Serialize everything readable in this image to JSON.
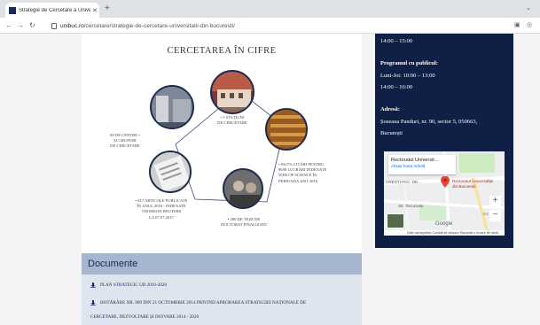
{
  "browser": {
    "tab_title": "Strategie de Cercetare a Universit",
    "new_tab": "+",
    "url_host": "unibuc.ro",
    "url_path": "/cercetare/strategie-de-cercetare-universitatii-din-bucuresti/"
  },
  "research": {
    "title": "CERCETAREA ÎN CIFRE",
    "captions": [
      "• 5 STAȚIUNI\nDE CERCETARE",
      "• 9327% CITĂRI PENTRU\n9698 LUCRĂRI INDEXATE\nWEB OF SCIENCE ÎN\nPERIOADA 2001-2016",
      "• 280 DE TEZE DE\nDOCTORAT FINALIZATE",
      "• 817 ARTICOLE PUBLICATE\nÎN ANUL 2016 - INDEXATE\nTHOMSON-REUTERS\nLA 07.07.2017",
      "80 DE CENTRE •\nȘI GRUPURI\nDE CERCETARE"
    ]
  },
  "documents": {
    "heading": "Documente",
    "items": [
      "PLAN STRATEGIC UB 2016-2020",
      "HOTĂRÂRE NR. 909 DIN 21 OCTOMBRIE 2014 PRIVIND APROBAREA STRATEGIEI NAȚIONALE DE",
      "CERCETARE, DEZVOLTARE ȘI INOVARE 2014 - 2020"
    ]
  },
  "sidebar": {
    "hours_top": "14:00 – 15:00",
    "public_hours_label": "Programul cu publicul:",
    "public_hours_1": "Luni-Joi: 10:00 – 13:00",
    "public_hours_2": "14:00 – 16:00",
    "address_label": "Adresă:",
    "address_line1": "Șoseaua Panduri, nr. 90, sector 5, 050663,",
    "address_line2": "București",
    "map": {
      "popup_name": "Rectoratul Universit...",
      "popup_link": "Afișați harta mărită",
      "pin_label": "Rectoratul Universității din București",
      "area_left": "URESTI-FAC. DE...",
      "street": "Str. Tecuciului",
      "ce_label": "Ce",
      "google": "Google",
      "footer": "Date cartografice   Condiții de utilizare   Raportați o eroare de hartă"
    },
    "colors": {
      "sidebar_bg": "#0f1f45",
      "docs_head": "#a7b6cf"
    }
  }
}
